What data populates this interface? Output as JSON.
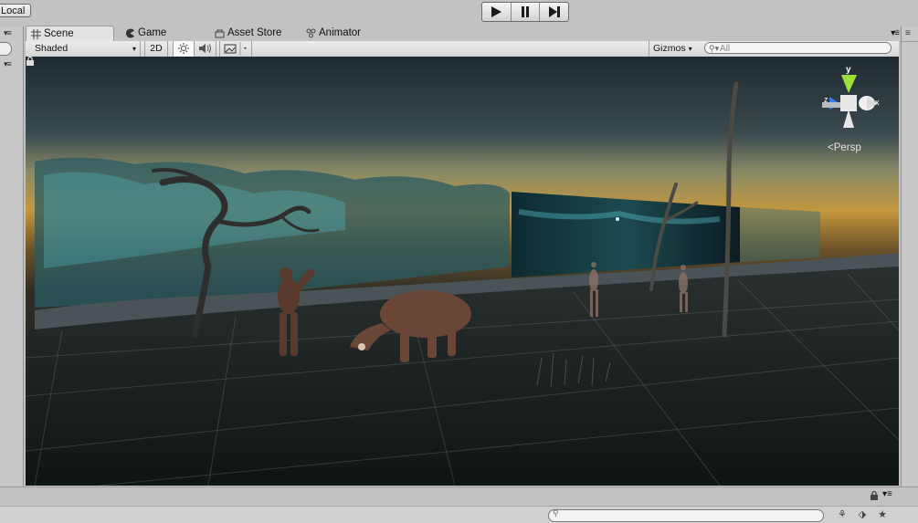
{
  "toolbar": {
    "pivot_rotation": "Local",
    "play_icon": "play-icon",
    "pause_icon": "pause-icon",
    "step_icon": "step-icon"
  },
  "tabs": [
    {
      "label": "Scene",
      "icon": "grid-icon",
      "active": true
    },
    {
      "label": "Game",
      "icon": "pacman-icon",
      "active": false
    },
    {
      "label": "Asset Store",
      "icon": "store-icon",
      "active": false
    },
    {
      "label": "Animator",
      "icon": "animator-icon",
      "active": false
    }
  ],
  "scene_toolbar": {
    "draw_mode": "Shaded",
    "mode_2d": "2D",
    "gizmos": "Gizmos",
    "search_placeholder": "All"
  },
  "viewport": {
    "projection": "Persp",
    "gizmo_y_label": "y",
    "gizmo_z_label": "z",
    "gizmo_x_label": "x"
  },
  "colors": {
    "panel_bg": "#c2c2c2",
    "active_tab": "#e3e3e3",
    "gizmo_y": "#9ee03a",
    "gizmo_z": "#3d7df0",
    "gizmo_x": "#e04040"
  }
}
